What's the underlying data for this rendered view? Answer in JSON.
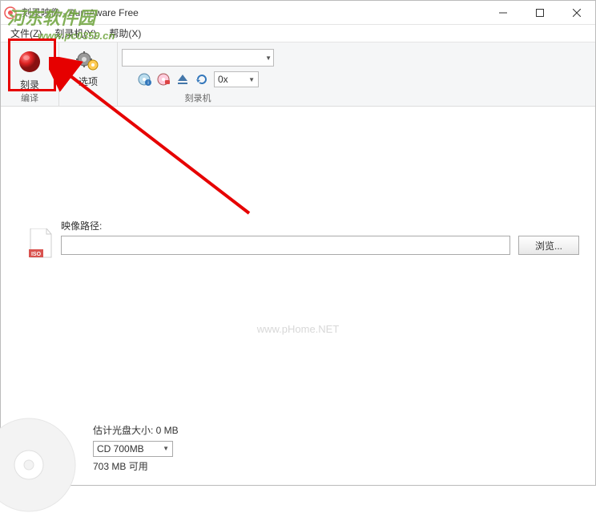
{
  "window": {
    "title": "刻录映像 - BurnAware Free"
  },
  "menubar": {
    "file": "文件(Z)",
    "recorder": "刻录机(Y)",
    "help": "帮助(X)"
  },
  "ribbon": {
    "burn_label": "刻录",
    "compile_group": "编译",
    "options_label": "选项",
    "recorder_group": "刻录机",
    "speed_value": "0x"
  },
  "main": {
    "image_path_label": "映像路径:",
    "path_value": "",
    "browse_label": "浏览..."
  },
  "disc": {
    "estimate_label": "估计光盘大小: 0 MB",
    "disc_type": "CD 700MB",
    "free_space": "703 MB 可用"
  },
  "watermark": {
    "site_name": "河东软件园",
    "site_url": "www.pc0359.cn",
    "center": "www.pHome.NET"
  }
}
